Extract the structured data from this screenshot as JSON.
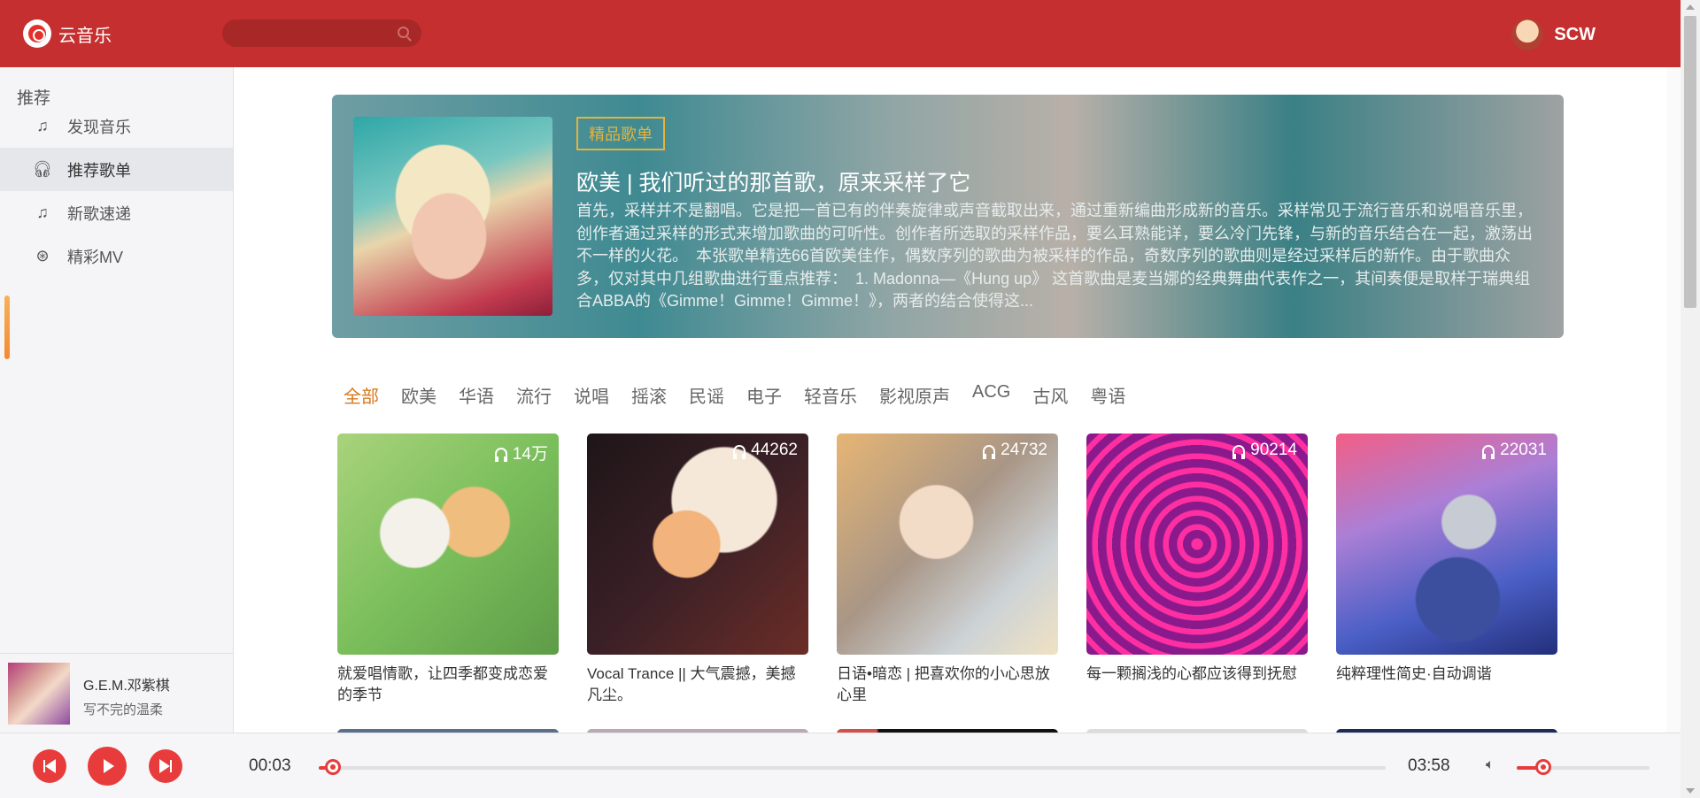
{
  "app": {
    "name": "云音乐"
  },
  "search": {
    "placeholder": ""
  },
  "user": {
    "name": "SCW"
  },
  "sidebar": {
    "title": "推荐",
    "items": [
      {
        "label": "发现音乐",
        "icon": "music-note-icon",
        "active": false
      },
      {
        "label": "推荐歌单",
        "icon": "headphones-icon",
        "active": true
      },
      {
        "label": "新歌速递",
        "icon": "music-note-icon",
        "active": false
      },
      {
        "label": "精彩MV",
        "icon": "film-reel-icon",
        "active": false
      }
    ]
  },
  "now_playing": {
    "title": "G.E.M.邓紫棋",
    "artist": "写不完的温柔"
  },
  "banner": {
    "badge": "精品歌单",
    "title": "欧美 | 我们听过的那首歌，原来采样了它",
    "description": "首先，采样并不是翻唱。它是把一首已有的伴奏旋律或声音截取出来，通过重新编曲形成新的音乐。采样常见于流行音乐和说唱音乐里，创作者通过采样的形式来增加歌曲的可听性。创作者所选取的采样作品，要么耳熟能详，要么冷门先锋，与新的音乐结合在一起，激荡出不一样的火花。　本张歌单精选66首欧美佳作，偶数序列的歌曲为被采样的作品，奇数序列的歌曲则是经过采样后的新作。由于歌曲众多，仅对其中几组歌曲进行重点推荐：　1. Madonna—《Hung up》 这首歌曲是麦当娜的经典舞曲代表作之一，其间奏便是取样于瑞典组合ABBA的《Gimme！Gimme！Gimme！》，两者的结合使得这..."
  },
  "categories": [
    "全部",
    "欧美",
    "华语",
    "流行",
    "说唱",
    "摇滚",
    "民谣",
    "电子",
    "轻音乐",
    "影视原声",
    "ACG",
    "古风",
    "粤语"
  ],
  "active_category": "全部",
  "playlists": [
    {
      "title": "就爱唱情歌，让四季都变成恋爱的季节",
      "play_count": "14万"
    },
    {
      "title": "Vocal Trance || 大气震撼，美撼凡尘。",
      "play_count": "44262"
    },
    {
      "title": "日语•暗恋 | 把喜欢你的小心思放心里",
      "play_count": "24732"
    },
    {
      "title": "每一颗搁浅的心都应该得到抚慰",
      "play_count": "90214"
    },
    {
      "title": "纯粹理性简史·自动调谐",
      "play_count": "22031"
    }
  ],
  "player": {
    "current_time": "00:03",
    "total_time": "03:58",
    "progress": 0.013,
    "volume": 0.2
  },
  "colors": {
    "header": "#c62f2f",
    "accent": "#e83c3c",
    "active_category": "#d8781c",
    "badge": "#e5b33c"
  }
}
